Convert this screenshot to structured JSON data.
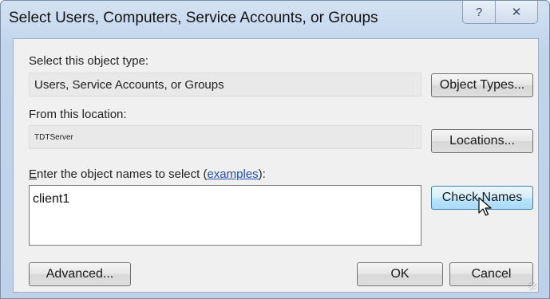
{
  "window": {
    "title": "Select Users, Computers, Service Accounts, or Groups",
    "help_glyph": "?",
    "close_glyph": "✕"
  },
  "object_type": {
    "label": "Select this object type:",
    "value": "Users, Service Accounts, or Groups",
    "button": "Object Types..."
  },
  "location": {
    "label": "From this location:",
    "value": "TDTServer",
    "button": "Locations..."
  },
  "names": {
    "label_prefix": "E",
    "label_main": "nter the object names to select (",
    "label_link": "examples",
    "label_suffix": "):",
    "value": "client1",
    "button": "Check Names"
  },
  "footer": {
    "advanced": "Advanced...",
    "ok": "OK",
    "cancel": "Cancel"
  }
}
